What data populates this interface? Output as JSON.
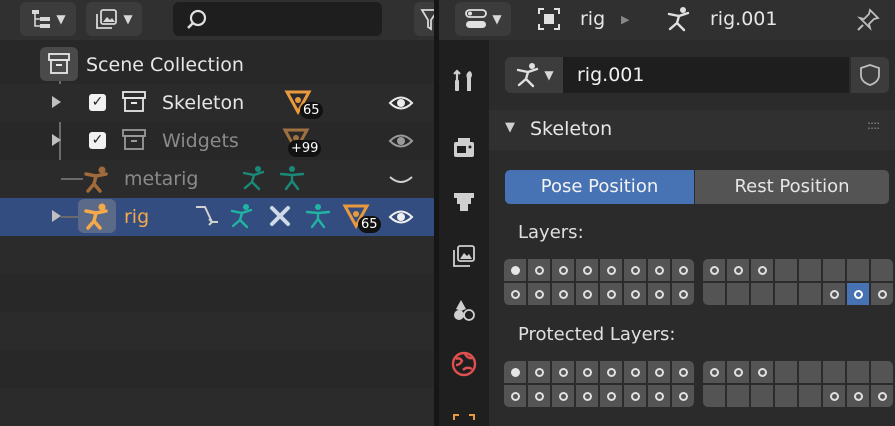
{
  "colors": {
    "accent_blue": "#4772b3",
    "row_selected": "#334d80",
    "armature_orange": "#f5a94a",
    "bone_teal": "#1fb5a0",
    "mesh_orange": "#e89a3c",
    "props_tab_red": "#e05050"
  },
  "outliner": {
    "header": {
      "display_mode_icon": "outliner-display-mode-icon",
      "filter_icon": "image-filter-icon",
      "search": {
        "value": "",
        "placeholder": ""
      }
    },
    "rows": [
      {
        "label": "Scene Collection",
        "icon": "scene-collection-icon"
      },
      {
        "label": "Skeleton",
        "icon": "collection-icon",
        "checked": true,
        "badge": "65",
        "visible": true
      },
      {
        "label": "Widgets",
        "icon": "collection-icon",
        "checked": true,
        "badge": "+99",
        "visible": true
      },
      {
        "label": "metarig",
        "icon": "armature-icon",
        "visible": false
      },
      {
        "label": "rig",
        "icon": "armature-icon",
        "badge": "65",
        "visible": true,
        "selected": true
      }
    ]
  },
  "properties": {
    "breadcrumb": {
      "object": "rig",
      "data": "rig.001"
    },
    "datablock_name": "rig.001",
    "panel_title": "Skeleton",
    "pose_position_label": "Pose Position",
    "rest_position_label": "Rest Position",
    "pose_position_active": true,
    "layers_label": "Layers:",
    "protected_layers_label": "Protected Layers:",
    "layers": {
      "used": [
        0,
        1,
        2,
        3,
        4,
        5,
        6,
        7,
        8,
        9,
        10,
        16,
        17,
        18,
        19,
        20,
        21,
        22,
        23,
        29,
        30,
        31
      ],
      "active": [
        0,
        30
      ],
      "filled": [
        0
      ]
    },
    "protected_layers": {
      "used": [
        0,
        1,
        2,
        3,
        4,
        5,
        6,
        7,
        8,
        9,
        10,
        16,
        17,
        18,
        19,
        20,
        21,
        22,
        23,
        29,
        30,
        31
      ],
      "filled": [
        0
      ]
    },
    "tabs": [
      "tool-icon",
      "render-icon",
      "output-icon",
      "view-layer-icon",
      "scene-icon",
      "world-icon",
      "object-icon"
    ]
  }
}
